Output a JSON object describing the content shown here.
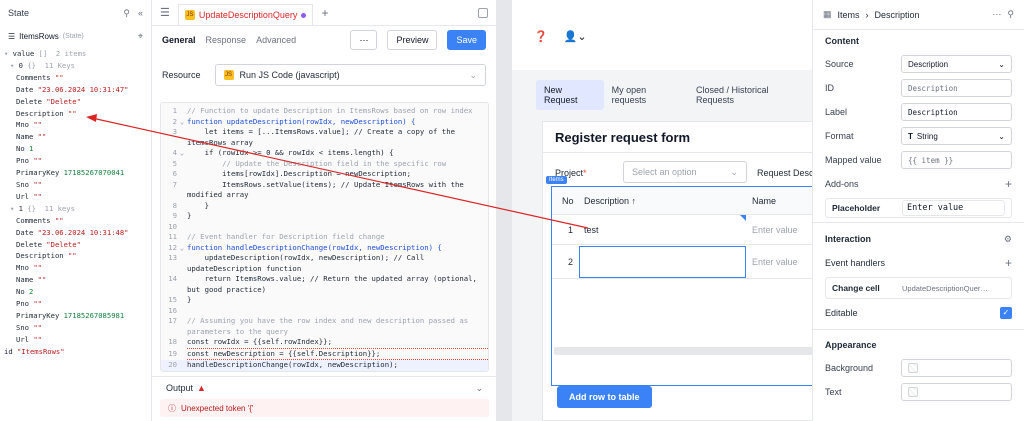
{
  "state_panel": {
    "title": "State",
    "var_name": "ItemsRows",
    "var_tag": "(State)",
    "tree": [
      {
        "indent": 0,
        "key": "value",
        "meta": "[]  2 items",
        "caret": "▾"
      },
      {
        "indent": 1,
        "key": "0",
        "meta": "{}  11 Keys",
        "caret": "▾"
      },
      {
        "indent": 2,
        "key": "Comments",
        "val": "\"\"",
        "t": "s"
      },
      {
        "indent": 2,
        "key": "Date",
        "val": "\"23.06.2024 10:31:47\"",
        "t": "s"
      },
      {
        "indent": 2,
        "key": "Delete",
        "val": "\"Delete\"",
        "t": "s"
      },
      {
        "indent": 2,
        "key": "Description",
        "val": "\"\"",
        "t": "s"
      },
      {
        "indent": 2,
        "key": "Mno",
        "val": "\"\"",
        "t": "s"
      },
      {
        "indent": 2,
        "key": "Name",
        "val": "\"\"",
        "t": "s"
      },
      {
        "indent": 2,
        "key": "No",
        "val": "1",
        "t": "n"
      },
      {
        "indent": 2,
        "key": "Pno",
        "val": "\"\"",
        "t": "s"
      },
      {
        "indent": 2,
        "key": "PrimaryKey",
        "val": "17185267070041",
        "t": "n"
      },
      {
        "indent": 2,
        "key": "Sno",
        "val": "\"\"",
        "t": "s"
      },
      {
        "indent": 2,
        "key": "Url",
        "val": "\"\"",
        "t": "s"
      },
      {
        "indent": 1,
        "key": "1",
        "meta": "{}  11 keys",
        "caret": "▾"
      },
      {
        "indent": 2,
        "key": "Comments",
        "val": "\"\"",
        "t": "s"
      },
      {
        "indent": 2,
        "key": "Date",
        "val": "\"23.06.2024 10:31:48\"",
        "t": "s"
      },
      {
        "indent": 2,
        "key": "Delete",
        "val": "\"Delete\"",
        "t": "s"
      },
      {
        "indent": 2,
        "key": "Description",
        "val": "\"\"",
        "t": "s"
      },
      {
        "indent": 2,
        "key": "Mno",
        "val": "\"\"",
        "t": "s"
      },
      {
        "indent": 2,
        "key": "Name",
        "val": "\"\"",
        "t": "s"
      },
      {
        "indent": 2,
        "key": "No",
        "val": "2",
        "t": "n"
      },
      {
        "indent": 2,
        "key": "Pno",
        "val": "\"\"",
        "t": "s"
      },
      {
        "indent": 2,
        "key": "PrimaryKey",
        "val": "17185267085981",
        "t": "n"
      },
      {
        "indent": 2,
        "key": "Sno",
        "val": "\"\"",
        "t": "s"
      },
      {
        "indent": 2,
        "key": "Url",
        "val": "\"\"",
        "t": "s"
      },
      {
        "indent": 0,
        "key": "id",
        "val": "\"ItemsRows\"",
        "t": "s"
      }
    ]
  },
  "query": {
    "tab_name": "UpdateDescriptionQuery",
    "tab_icon": "JS",
    "subtabs": [
      "General",
      "Response",
      "Advanced"
    ],
    "preview_label": "Preview",
    "save_label": "Save",
    "resource_label": "Resource",
    "resource_value": "Run JS Code (javascript)",
    "code": [
      {
        "n": "1",
        "c": "// Function to update Description in ItemsRows based on row index",
        "cls": "cm"
      },
      {
        "n": "2",
        "f": "⌄",
        "c": "function updateDescription(rowIdx, newDescription) {",
        "cls": "kw"
      },
      {
        "n": "3",
        "c": "    let items = [...ItemsRows.value]; // Create a copy of the itemsRows array"
      },
      {
        "n": "4",
        "f": "⌄",
        "c": "    if (rowIdx >= 0 && rowIdx < items.length) {"
      },
      {
        "n": "5",
        "c": "        // Update the Description field in the specific row",
        "cls": "cm"
      },
      {
        "n": "6",
        "c": "        items[rowIdx].Description = newDescription;"
      },
      {
        "n": "7",
        "c": "        ItemsRows.setValue(items); // Update ItemsRows with the modified array"
      },
      {
        "n": "8",
        "c": "    }"
      },
      {
        "n": "9",
        "c": "}"
      },
      {
        "n": "10",
        "c": ""
      },
      {
        "n": "11",
        "c": "// Event handler for Description field change",
        "cls": "cm"
      },
      {
        "n": "12",
        "f": "⌄",
        "c": "function handleDescriptionChange(rowIdx, newDescription) {",
        "cls": "kw"
      },
      {
        "n": "13",
        "c": "    updateDescription(rowIdx, newDescription); // Call updateDescription function"
      },
      {
        "n": "14",
        "c": "    return ItemsRows.value; // Return the updated array (optional, but good practice)"
      },
      {
        "n": "15",
        "c": "}"
      },
      {
        "n": "16",
        "c": ""
      },
      {
        "n": "17",
        "c": "// Assuming you have the row index and new description passed as parameters to the query",
        "cls": "cm"
      },
      {
        "n": "18",
        "c": "const rowIdx = {{self.rowIndex}};"
      },
      {
        "n": "19",
        "c": "const newDescription = {{self.Description}};"
      },
      {
        "n": "20",
        "c": "handleDescriptionChange(rowIdx, newDescription);",
        "hl": true
      }
    ],
    "output_label": "Output",
    "error_text": "Unexpected token '{'"
  },
  "canvas": {
    "tabs": [
      "New Request",
      "My open requests",
      "Closed / Historical Requests"
    ],
    "form_title": "Register request form",
    "project_label": "Project",
    "project_placeholder": "Select an option",
    "request_label": "Request Descri",
    "table_tag": "Items",
    "table": {
      "headers": [
        "No",
        "Description ↑",
        "Name"
      ],
      "rows": [
        {
          "no": "1",
          "desc": "test",
          "name": "Enter value"
        },
        {
          "no": "2",
          "desc": "",
          "name": "Enter value"
        }
      ]
    },
    "add_row_label": "Add row to table"
  },
  "inspector": {
    "breadcrumb_parent": "Items",
    "breadcrumb_sep": "›",
    "breadcrumb_child": "Description",
    "content_title": "Content",
    "source_label": "Source",
    "source_value": "Description",
    "id_label": "ID",
    "id_value": "Description",
    "label_label": "Label",
    "label_value": "Description",
    "format_label": "Format",
    "format_value": "String",
    "mapped_label": "Mapped value",
    "mapped_value": "{{ item }}",
    "addons_label": "Add-ons",
    "placeholder_label": "Placeholder",
    "placeholder_value": "Enter value",
    "interaction_title": "Interaction",
    "handlers_label": "Event handlers",
    "change_cell_label": "Change cell",
    "change_cell_value": "UpdateDescriptionQuer…",
    "editable_label": "Editable",
    "appearance_title": "Appearance",
    "background_label": "Background",
    "text_label": "Text"
  },
  "colors": {
    "accent": "#3b82f6",
    "error": "#dc2626",
    "arrow": "#dc2626"
  }
}
